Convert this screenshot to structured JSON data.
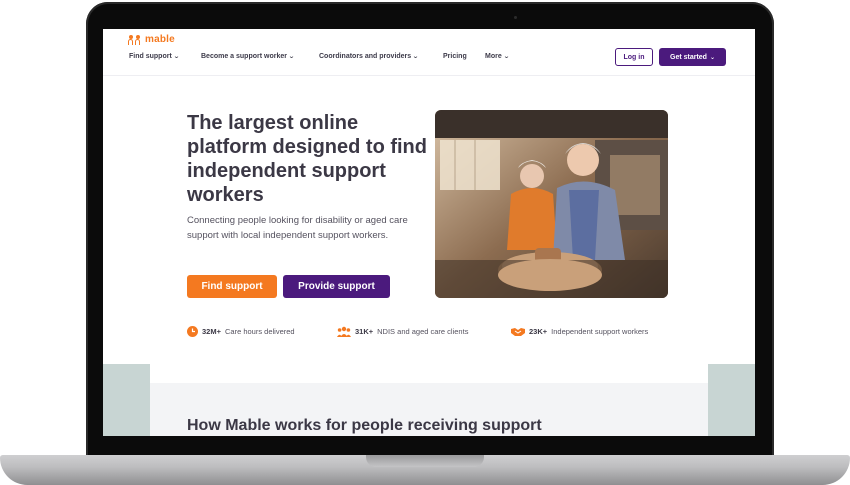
{
  "brand": {
    "logo_text": "mable",
    "accent": "#f47920",
    "purple": "#4b1a7d"
  },
  "nav": {
    "items": [
      {
        "label": "Find support"
      },
      {
        "label": "Become a support worker"
      },
      {
        "label": "Coordinators and providers"
      },
      {
        "label": "Pricing"
      },
      {
        "label": "More"
      }
    ],
    "login_label": "Log in",
    "get_started_label": "Get started"
  },
  "hero": {
    "title": "The largest online platform designed to find independent support workers",
    "subtitle": "Connecting people looking for disability or aged care support with local independent support workers.",
    "find_support_label": "Find support",
    "provide_support_label": "Provide support"
  },
  "stats": [
    {
      "value": "32M+",
      "label": "Care hours delivered",
      "icon": "clock-icon"
    },
    {
      "value": "31K+",
      "label": "NDIS and aged care clients",
      "icon": "people-group-icon"
    },
    {
      "value": "23K+",
      "label": "Independent support workers",
      "icon": "handshake-icon"
    }
  ],
  "section": {
    "title": "How Mable works for people receiving support"
  }
}
